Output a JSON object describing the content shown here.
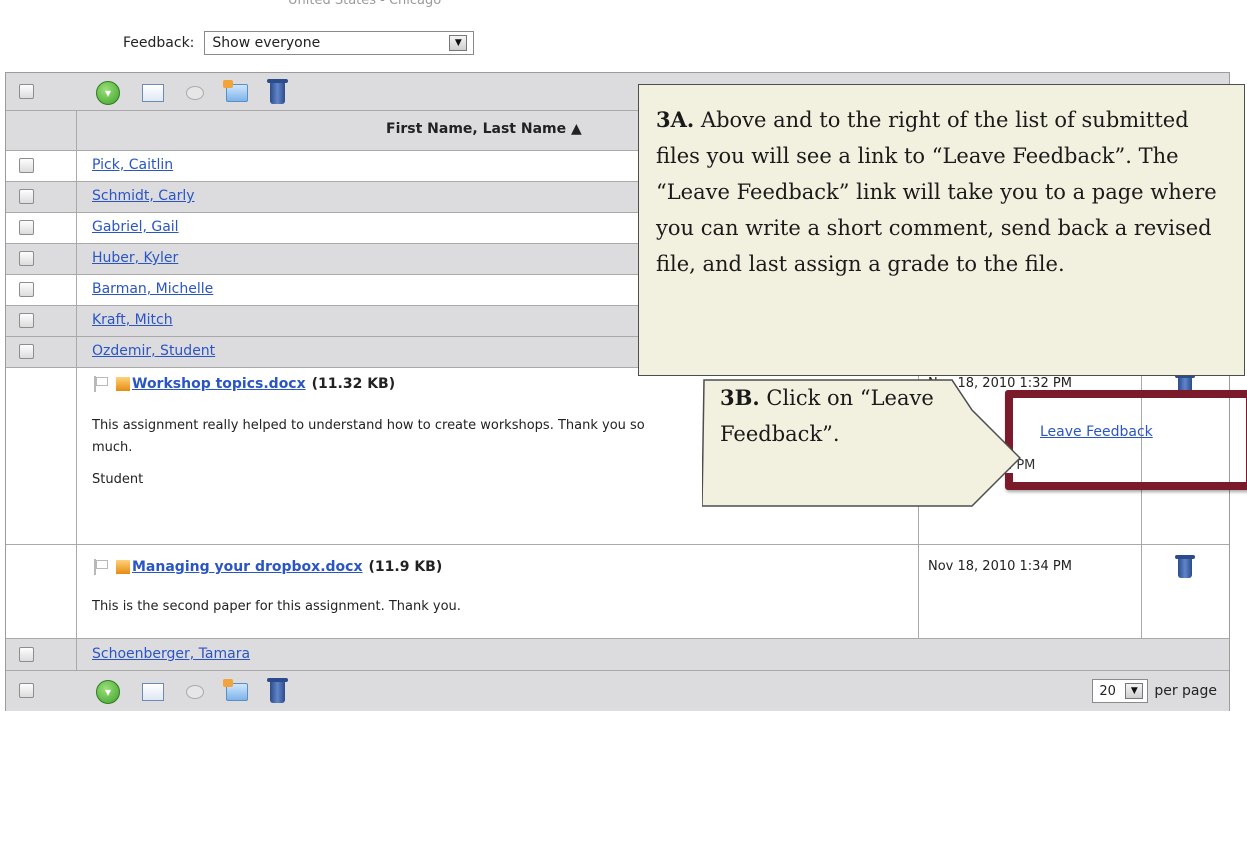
{
  "top": {
    "cut_text": "United States - Chicago",
    "feedback_label": "Feedback:",
    "feedback_select": "Show everyone"
  },
  "toolbar_icons": [
    "green-circle-icon",
    "document-icon",
    "disk-icon",
    "folder-icon",
    "trash-icon"
  ],
  "table": {
    "column_header": "First Name, Last Name ▲",
    "students": [
      "Pick, Caitlin",
      "Schmidt, Carly",
      "Gabriel, Gail",
      "Huber, Kyler",
      "Barman, Michelle",
      "Kraft, Mitch",
      "Ozdemir, Student"
    ],
    "leave_feedback": "Leave Feedback",
    "submissions": [
      {
        "file": "Workshop topics.docx",
        "size": "(11.32 KB)",
        "comment_1": "This assignment really helped to understand how to create workshops. Thank you so",
        "comment_2": "much.",
        "signature": "Student",
        "date": "Nov 18, 2010 1:32 PM"
      },
      {
        "file": "Managing your dropbox.docx",
        "size": "(11.9 KB)",
        "comment_1": "This is the second paper for this assignment. Thank you.",
        "date": "Nov 18, 2010 1:34 PM"
      }
    ],
    "last_student": "Schoenberger, Tamara",
    "per_page_value": "20",
    "per_page_label": "per page"
  },
  "date_fragment_visible": "1:32 PM",
  "callout_a": {
    "label": "3A.",
    "text": "Above and to the right of the list of submitted files you will see a link to “Leave Feedback”. The “Leave Feedback” link will take you to a page where you can write a short comment, send back a revised file, and last assign a grade to the file."
  },
  "callout_b": {
    "label": "3B.",
    "text": "Click on “Leave Feedback”."
  },
  "colors": {
    "link": "#2a55c4",
    "callout_bg": "#f2f0df",
    "highlight_border": "#7a1a2a",
    "row_gray": "#dcdcdf"
  }
}
